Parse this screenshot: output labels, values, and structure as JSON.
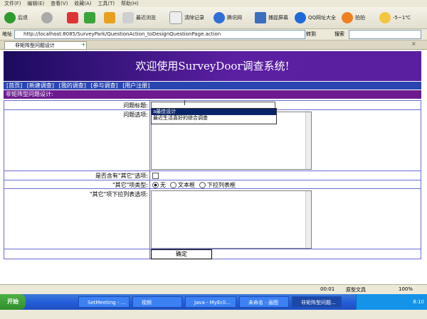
{
  "browser": {
    "menu": [
      "文件(F)",
      "编辑(E)",
      "查看(V)",
      "收藏(A)",
      "工具(T)",
      "帮助(H)"
    ],
    "toolbar": {
      "back": "后退",
      "recent": "最近浏览",
      "clear_history": "清除记录",
      "news": "腾讯网",
      "screenshot": "捕捉屏幕",
      "qq_sites": "QQ网址大全",
      "shoot": "拍拍",
      "weather": "-5~1℃"
    },
    "address_label": "地址",
    "address_url": "http://localhost:8085/SurveyPark/QuestionAction_toDesignQuestionPage.action",
    "go_label": "转到",
    "search_label": "搜索",
    "tab_title": "非矩阵型问题设计"
  },
  "page": {
    "banner_title": "欢迎使用SurveyDoor调查系统!",
    "nav": [
      "[首页]",
      "[新建调查]",
      "[我的调查]",
      "[参与调查]",
      "[用户注册]"
    ],
    "section_title": "非矩阵型问题设计:",
    "form": {
      "question_title_label": "问题标题:",
      "question_title_value": "",
      "dropdown_items": [
        "a最佳设计",
        "最近生活喜好的综合调查"
      ],
      "options_label": "问题选项:",
      "has_other_label": "是否含有\"其它\"选项:",
      "other_type_label": "\"其它\"项类型:",
      "other_type_options": [
        "无",
        "文本框",
        "下拉列表框"
      ],
      "other_type_selected": "无",
      "other_list_label": "\"其它\"项下拉列表选项:",
      "confirm_button": "确定"
    }
  },
  "statusbar": {
    "time_left": "00:01",
    "zone": "原型文具",
    "zoom": "100%"
  },
  "taskbar": {
    "start": "开始",
    "tasks": [
      "SetMeeting - ...",
      "视频",
      "Java - MyEcli...",
      "未命名 - 画图",
      "非矩阵型问题..."
    ],
    "clock": "8:10"
  }
}
